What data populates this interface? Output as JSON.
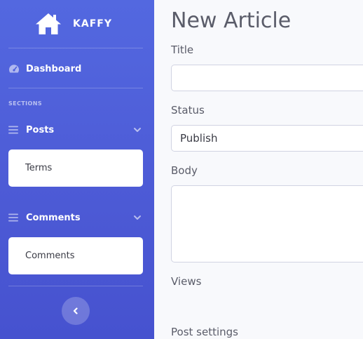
{
  "sidebar": {
    "brand": {
      "name": "KAFFY",
      "logo_icon": "home-icon"
    },
    "dashboard": {
      "label": "Dashboard",
      "icon": "tachometer-icon"
    },
    "section_heading": "SECTIONS",
    "groups": [
      {
        "label": "Posts",
        "icon": "bars-icon",
        "expanded": true,
        "items": [
          {
            "label": "Terms"
          }
        ]
      },
      {
        "label": "Comments",
        "icon": "bars-icon",
        "expanded": true,
        "items": [
          {
            "label": "Comments"
          }
        ]
      }
    ],
    "toggle_icon": "chevron-left-icon"
  },
  "main": {
    "title": "New Article",
    "fields": {
      "title": {
        "label": "Title",
        "value": ""
      },
      "status": {
        "label": "Status",
        "value": "Publish"
      },
      "body": {
        "label": "Body",
        "value": ""
      },
      "views": {
        "label": "Views"
      },
      "post_settings": {
        "label": "Post settings"
      }
    }
  },
  "colors": {
    "sidebar_top": "#5368e0",
    "sidebar_bottom": "#4652cf",
    "background": "#f8f9fc",
    "text": "#5a5c69",
    "border": "#d1d3e2"
  }
}
